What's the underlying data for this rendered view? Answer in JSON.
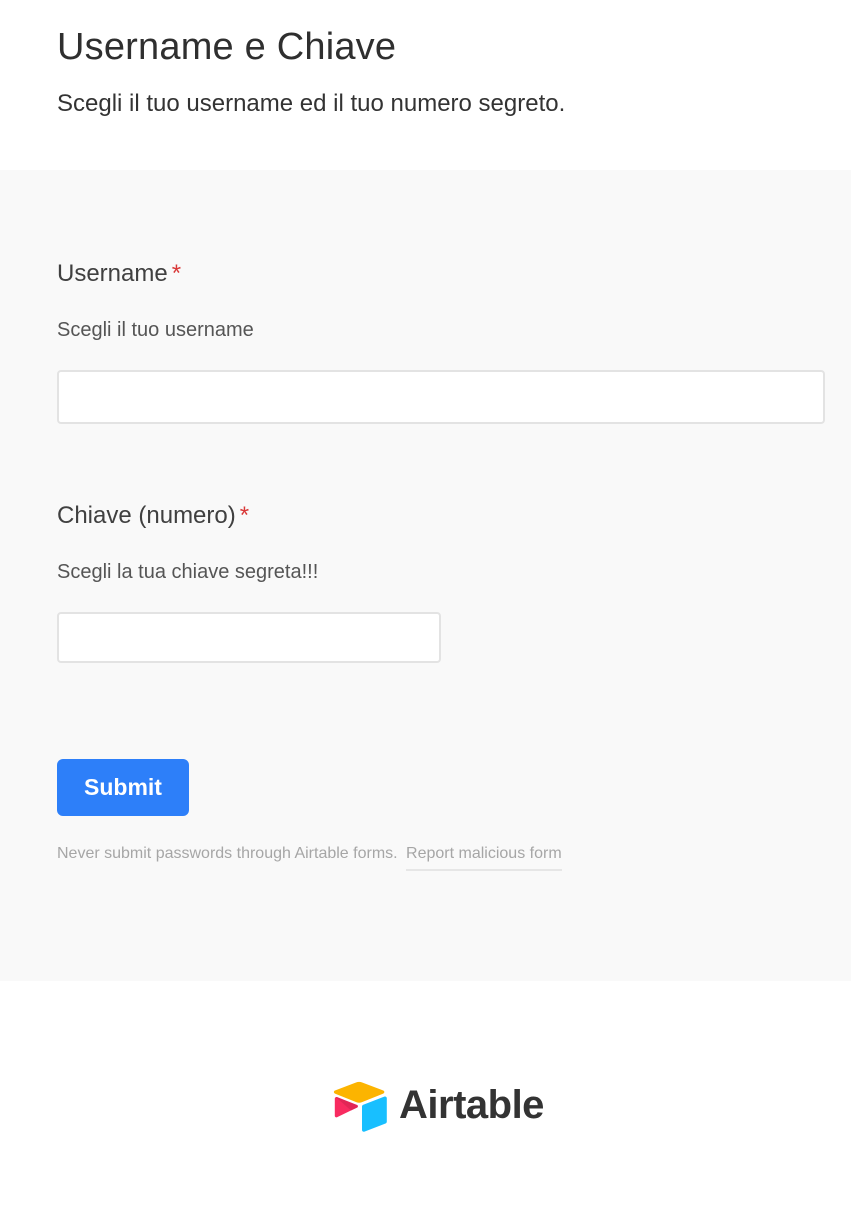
{
  "header": {
    "title": "Username e Chiave",
    "subtitle": "Scegli il tuo username ed il tuo numero segreto."
  },
  "fields": [
    {
      "label": "Username",
      "required_mark": "*",
      "description": "Scegli il tuo username",
      "value": "",
      "placeholder": ""
    },
    {
      "label": "Chiave (numero)",
      "required_mark": "*",
      "description": "Scegli la tua chiave segreta!!!",
      "value": "",
      "placeholder": ""
    }
  ],
  "submit": {
    "label": "Submit"
  },
  "notice": {
    "text": "Never submit passwords through Airtable forms.",
    "report_link": "Report malicious form"
  },
  "footer": {
    "logo_icon": "airtable-logo-icon",
    "logo_text": "Airtable"
  },
  "colors": {
    "accent": "#2d7ff9",
    "required": "#d93838",
    "form_background": "#f9f9f9",
    "logo_yellow": "#fcb400",
    "logo_blue": "#18bfff",
    "logo_red": "#f82b60"
  }
}
